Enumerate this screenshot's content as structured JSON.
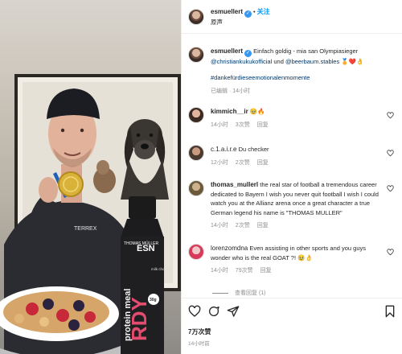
{
  "post": {
    "username": "esmuellert",
    "follow_label": "关注",
    "audio_label": "原声"
  },
  "caption": {
    "username": "esmuellert",
    "text": "Einfach goldig - mia san Olympiasieger",
    "mention_1": "@christiankukukofficial",
    "joiner": "und",
    "mention_2": "@beerbaum.stables",
    "emojis": "🏅❤️👌",
    "hashtag": "#dankefürdieseemotionalenmomente",
    "edited_label": "已编辑",
    "time_ago": "14小时"
  },
  "comments": [
    {
      "username": "kimmich__ir",
      "text": "🥹🔥",
      "time": "14小时",
      "likes": "3次赞",
      "reply_label": "回复"
    },
    {
      "username": "c.1.a.i.r.e",
      "text": "Du checker",
      "time": "12小时",
      "likes": "2次赞",
      "reply_label": "回复"
    },
    {
      "username": "thomas_mullerl",
      "text": "the real star of football a tremendous career dedicated to Bayern I wish you never quit football I wish I could watch you at the Allianz arena once a great character a true German legend his name is \"THOMAS MULLER\"",
      "time": "14小时",
      "likes": "2次赞",
      "reply_label": "回复"
    },
    {
      "username": "lorenzomdna",
      "text": "Even assisting in other sports and you guys wonder who is the real GOAT ?! 🥹👌",
      "time": "14小时",
      "likes": "79次赞",
      "reply_label": "回复"
    }
  ],
  "view_replies": "查看回复 (1)",
  "stats": {
    "likes": "7万次赞",
    "posted": "14小时前"
  },
  "media": {
    "bottle_brand": "ESN",
    "bottle_product": "protein meal",
    "bottle_flavor": "milk chocolate flavor",
    "bottle_small": "THOMAS MÜLLER",
    "bottle_big": "RDY",
    "bottle_badge": "30g",
    "shirt_brand": "TERREX"
  },
  "colors": {
    "accent": "#0095f6",
    "verified": "#3897f0",
    "meta": "#8e8e8e",
    "link": "#00376b"
  },
  "icons": {
    "like": "heart-icon",
    "comment": "comment-icon",
    "share": "share-icon",
    "save": "bookmark-icon"
  }
}
